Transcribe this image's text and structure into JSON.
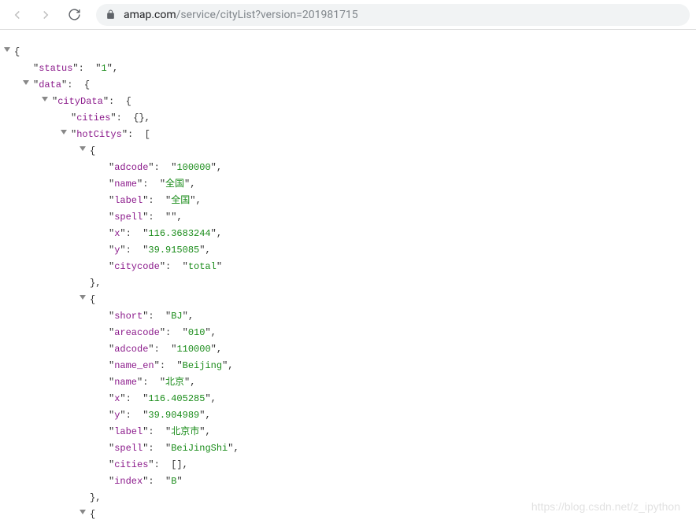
{
  "browser": {
    "url_domain": "amap.com",
    "url_path": "/service/cityList?version=201981715"
  },
  "json": {
    "status": {
      "key": "status",
      "value": "1"
    },
    "data": {
      "key": "data"
    },
    "cityData": {
      "key": "cityData"
    },
    "cities": {
      "key": "cities"
    },
    "hotCitys": {
      "key": "hotCitys"
    },
    "item0": {
      "adcode": {
        "key": "adcode",
        "value": "100000"
      },
      "name": {
        "key": "name",
        "value": "全国"
      },
      "label": {
        "key": "label",
        "value": "全国"
      },
      "spell": {
        "key": "spell",
        "value": ""
      },
      "x": {
        "key": "x",
        "value": "116.3683244"
      },
      "y": {
        "key": "y",
        "value": "39.915085"
      },
      "citycode": {
        "key": "citycode",
        "value": "total"
      }
    },
    "item1": {
      "short": {
        "key": "short",
        "value": "BJ"
      },
      "areacode": {
        "key": "areacode",
        "value": "010"
      },
      "adcode": {
        "key": "adcode",
        "value": "110000"
      },
      "name_en": {
        "key": "name_en",
        "value": "Beijing"
      },
      "name": {
        "key": "name",
        "value": "北京"
      },
      "x": {
        "key": "x",
        "value": "116.405285"
      },
      "y": {
        "key": "y",
        "value": "39.904989"
      },
      "label": {
        "key": "label",
        "value": "北京市"
      },
      "spell": {
        "key": "spell",
        "value": "BeiJingShi"
      },
      "cities": {
        "key": "cities"
      },
      "index": {
        "key": "index",
        "value": "B"
      }
    }
  },
  "watermark": "https://blog.csdn.net/z_ipython"
}
